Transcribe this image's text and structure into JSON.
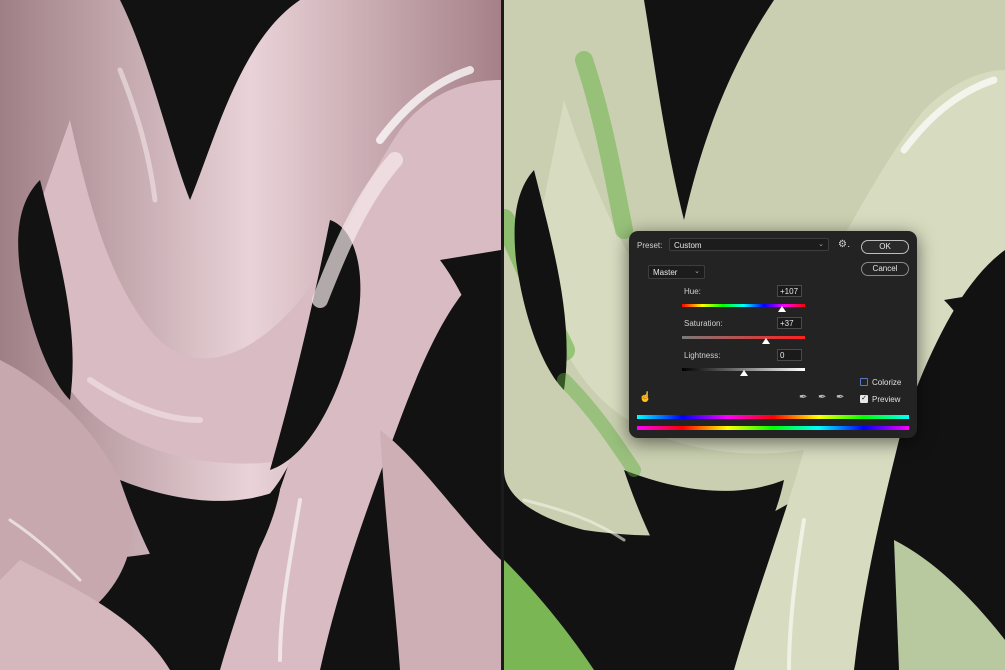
{
  "dialog": {
    "preset_label": "Preset:",
    "preset_value": "Custom",
    "ok_label": "OK",
    "cancel_label": "Cancel",
    "channel": "Master",
    "hue": {
      "label": "Hue:",
      "value": "+107",
      "position": 0.81
    },
    "saturation": {
      "label": "Saturation:",
      "value": "+37",
      "position": 0.68
    },
    "lightness": {
      "label": "Lightness:",
      "value": "0",
      "position": 0.5
    },
    "colorize": {
      "label": "Colorize",
      "checked": false
    },
    "preview": {
      "label": "Preview",
      "checked": true
    }
  },
  "icons": [
    "gear-icon",
    "hand-targeted-adjust-icon",
    "eyedropper-icon",
    "eyedropper-plus-icon",
    "eyedropper-minus-icon",
    "chevron-down-icon"
  ],
  "colors": {
    "dialog_bg": "#232323",
    "left_tint": "#e6c9cf",
    "right_tint_green": "#5fae3d",
    "background": "#111111"
  }
}
